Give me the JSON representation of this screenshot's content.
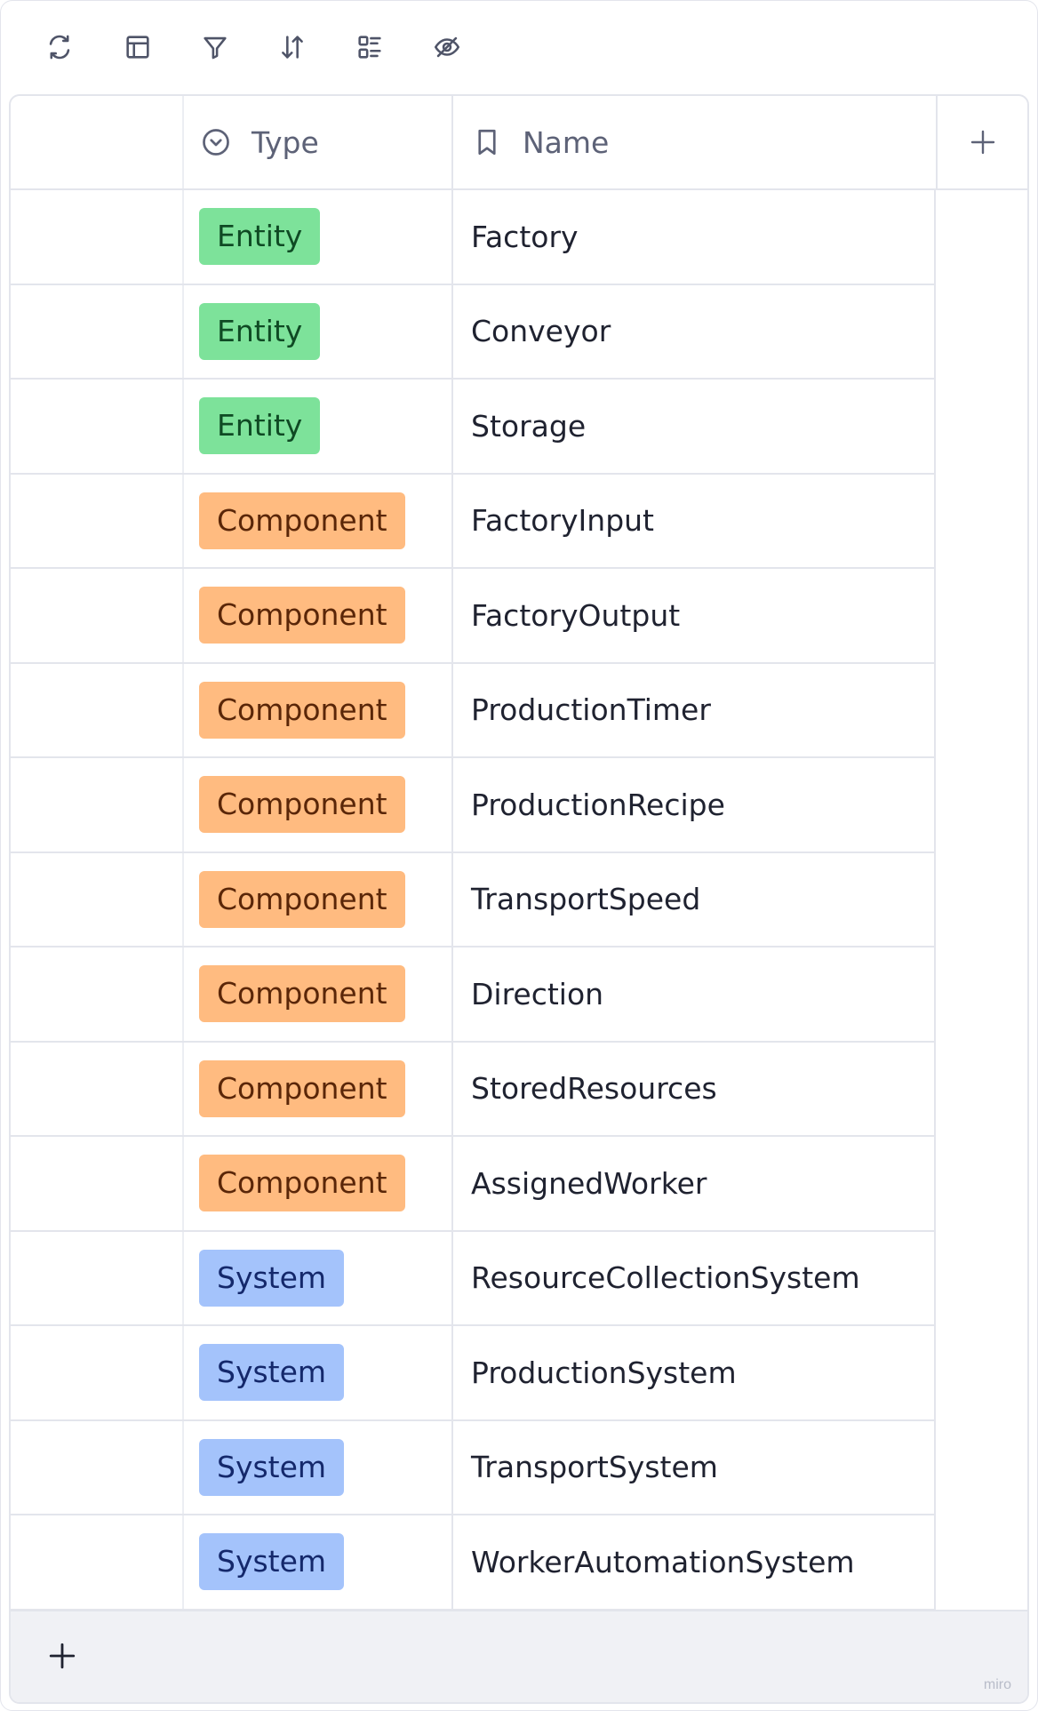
{
  "table": {
    "columns": [
      {
        "label": "Type",
        "icon": "circle-chevron-icon"
      },
      {
        "label": "Name",
        "icon": "bookmark-icon"
      }
    ],
    "rows": [
      {
        "type": "Entity",
        "name": "Factory"
      },
      {
        "type": "Entity",
        "name": "Conveyor"
      },
      {
        "type": "Entity",
        "name": "Storage"
      },
      {
        "type": "Component",
        "name": "FactoryInput"
      },
      {
        "type": "Component",
        "name": "FactoryOutput"
      },
      {
        "type": "Component",
        "name": "ProductionTimer"
      },
      {
        "type": "Component",
        "name": "ProductionRecipe"
      },
      {
        "type": "Component",
        "name": "TransportSpeed"
      },
      {
        "type": "Component",
        "name": "Direction"
      },
      {
        "type": "Component",
        "name": "StoredResources"
      },
      {
        "type": "Component",
        "name": "AssignedWorker"
      },
      {
        "type": "System",
        "name": "ResourceCollectionSystem"
      },
      {
        "type": "System",
        "name": "ProductionSystem"
      },
      {
        "type": "System",
        "name": "TransportSystem"
      },
      {
        "type": "System",
        "name": "WorkerAutomationSystem"
      }
    ]
  },
  "tag_colors": {
    "Entity": "#7de29a",
    "Component": "#ffbb80",
    "System": "#a4c3fb"
  },
  "toolbar": {
    "icons": [
      "sync-icon",
      "layout-icon",
      "filter-icon",
      "sort-icon",
      "list-fields-icon",
      "hide-eye-icon"
    ]
  },
  "brand": "miro"
}
